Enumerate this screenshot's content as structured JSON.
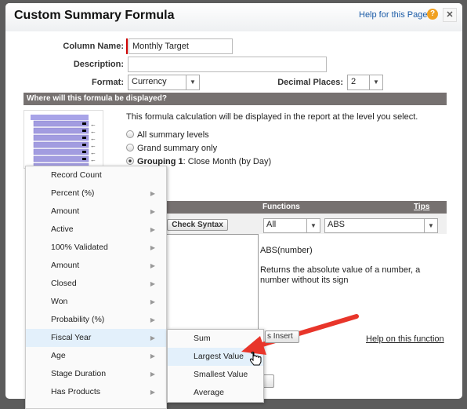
{
  "dialog": {
    "title": "Custom Summary Formula",
    "help_link": "Help for this Page",
    "help_icon": "question-circle-icon",
    "close_icon": "close-icon"
  },
  "form": {
    "column_name_label": "Column Name:",
    "column_name_value": "Monthly Target",
    "description_label": "Description:",
    "description_value": "",
    "format_label": "Format:",
    "format_value": "Currency",
    "decimal_label": "Decimal Places:",
    "decimal_value": "2"
  },
  "display": {
    "header": "Where will this formula be displayed?",
    "intro": "This formula calculation will be displayed in the report at the level you select.",
    "options": [
      {
        "label": "All summary levels",
        "selected": false
      },
      {
        "label": "Grand summary only",
        "selected": false
      },
      {
        "label_bold": "Grouping 1",
        "label_rest": ": Close Month (by Day)",
        "selected": true
      }
    ]
  },
  "formula": {
    "functions_header": "Functions",
    "tips_link": "Tips",
    "check_syntax": "Check Syntax",
    "category_value": "All",
    "function_value": "ABS",
    "signature": "ABS(number)",
    "description": "Returns the absolute value of a number, a number without its sign",
    "insert_button": "s Insert",
    "help_function_link": "Help on this function"
  },
  "menu": {
    "items": [
      {
        "label": "Record Count",
        "sub": false
      },
      {
        "label": "Percent (%)",
        "sub": true
      },
      {
        "label": "Amount",
        "sub": true
      },
      {
        "label": "Active",
        "sub": true
      },
      {
        "label": "100% Validated",
        "sub": true
      },
      {
        "label": "Amount",
        "sub": true
      },
      {
        "label": "Closed",
        "sub": true
      },
      {
        "label": "Won",
        "sub": true
      },
      {
        "label": "Probability (%)",
        "sub": true
      },
      {
        "label": "Fiscal Year",
        "sub": true,
        "highlighted": true
      },
      {
        "label": "Age",
        "sub": true
      },
      {
        "label": "Stage Duration",
        "sub": true
      },
      {
        "label": "Has Products",
        "sub": true
      }
    ]
  },
  "submenu": {
    "items": [
      {
        "label": "Sum"
      },
      {
        "label": "Largest Value",
        "highlighted": true
      },
      {
        "label": "Smallest Value"
      },
      {
        "label": "Average"
      }
    ]
  },
  "colors": {
    "annotation_arrow": "#e8352a",
    "section_bar": "#767170",
    "highlight": "#e3f0fb"
  }
}
